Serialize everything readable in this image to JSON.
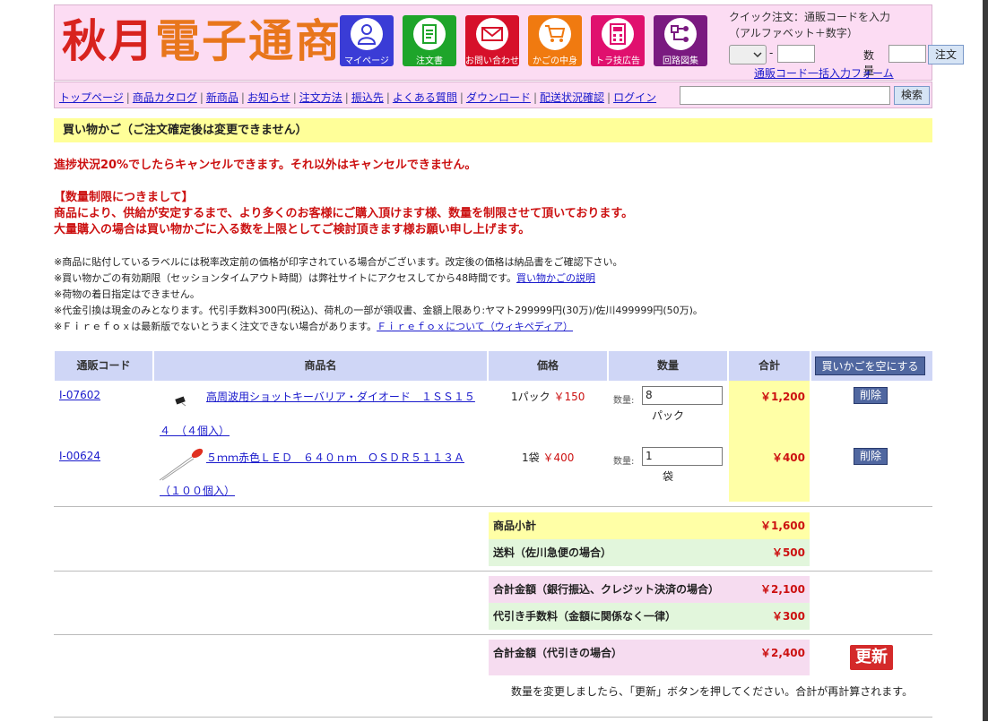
{
  "header": {
    "logo_part1": "秋月",
    "logo_part2": "電子通商",
    "icons": [
      {
        "label": "マイページ",
        "icon": "person-icon",
        "color": "#3a3cd6"
      },
      {
        "label": "注文書",
        "icon": "order-form-icon",
        "color": "#1ea52a"
      },
      {
        "label": "お問い合わせ",
        "icon": "mail-icon",
        "color": "#d6102a"
      },
      {
        "label": "かごの中身",
        "icon": "cart-icon",
        "color": "#f07a10"
      },
      {
        "label": "トラ技広告",
        "icon": "calculator-icon",
        "color": "#e0106e"
      },
      {
        "label": "回路図集",
        "icon": "circuit-icon",
        "color": "#7a1a80"
      }
    ],
    "quick_order_title": "クイック注文：通販コードを入力",
    "quick_order_sub": "（アルファベット＋数字）",
    "dash": "-",
    "qty_label": "数量",
    "order_button": "注文",
    "bulk_link": "通販コード一括入力フォーム"
  },
  "nav": {
    "links": [
      "トップページ",
      "商品カタログ",
      "新商品",
      "お知らせ",
      "注文方法",
      "振込先",
      "よくある質問",
      "ダウンロード",
      "配送状況確認",
      "ログイン"
    ],
    "sep": "|",
    "search_button": "検索"
  },
  "cart": {
    "title": "買い物かご（ご注文確定後は変更できません）",
    "cancel_notice": "進捗状況20%でしたらキャンセルできます。それ以外はキャンセルできません。",
    "limit_head": "【数量制限につきまして】",
    "limit_line1": "商品により、供給が安定するまで、より多くのお客様にご購入頂けます様、数量を制限させて頂いております。",
    "limit_line2": "大量購入の場合は買い物かごに入る数を上限としてご検討頂きます様お願い申し上げます。",
    "note1": "※商品に貼付しているラベルには税率改定前の価格が印字されている場合がございます。改定後の価格は納品書をご確認下さい。",
    "note2_text": "※買い物かごの有効期限（セッションタイムアウト時間）は弊社サイトにアクセスしてから48時間です。",
    "note2_link": "買い物かごの説明",
    "note3": "※荷物の着日指定はできません。",
    "note4": "※代金引換は現金のみとなります。代引手数料300円(税込)、荷札の一部が領収書、金額上限あり:ヤマト299999円(30万)/佐川499999円(50万)。",
    "note5_text": "※Ｆｉｒｅｆｏｘは最新版でないとうまく注文できない場合があります。",
    "note5_link": "Ｆｉｒｅｆｏｘについて（ウィキペディア）"
  },
  "table": {
    "headers": {
      "code": "通販コード",
      "name": "商品名",
      "price": "価格",
      "qty": "数量",
      "total": "合計"
    },
    "empty_button": "買いかごを空にする",
    "qty_prefix": "数量:",
    "delete_label": "削除",
    "items": [
      {
        "code": "I-07602",
        "name1": "高周波用ショットキーバリア・ダイオード　１ＳＳ１５",
        "name2": "４　（４個入）",
        "unit": "1パック",
        "price": "￥150",
        "qty": "8",
        "qty_unit": "パック",
        "total": "￥1,200"
      },
      {
        "code": "I-00624",
        "name1": "５ｍｍ赤色ＬＥＤ　６４０ｎｍ　ＯＳＤＲ５１１３Ａ",
        "name2": "（１００個入）",
        "unit": "1袋",
        "price": "￥400",
        "qty": "1",
        "qty_unit": "袋",
        "total": "￥400"
      }
    ]
  },
  "summary": {
    "subtotal_label": "商品小計",
    "subtotal": "￥1,600",
    "shipping_label": "送料（佐川急便の場合）",
    "shipping": "￥500",
    "total_bank_label": "合計金額（銀行振込、クレジット決済の場合）",
    "total_bank": "￥2,100",
    "cod_fee_label": "代引き手数料（金額に関係なく一律）",
    "cod_fee": "￥300",
    "total_cod_label": "合計金額（代引きの場合）",
    "total_cod": "￥2,400",
    "update_button": "更新",
    "update_note": "数量を変更しましたら、「更新」ボタンを押してください。合計が再計算されます。"
  }
}
